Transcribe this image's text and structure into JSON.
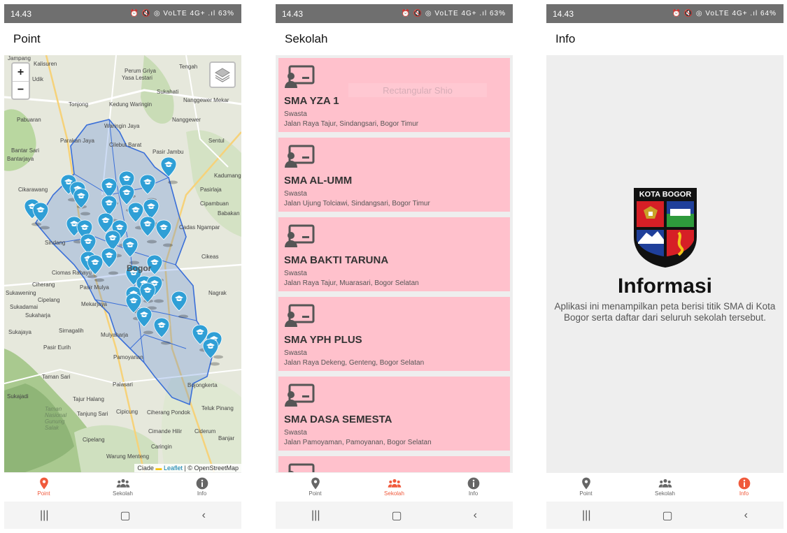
{
  "status": {
    "screen1": {
      "time": "14.43",
      "icons": "⏰ 🔇 ◎ VoLTE 4G+ .ıl",
      "battery": "63%"
    },
    "screen2": {
      "time": "14.43",
      "icons": "⏰ 🔇 ◎ VoLTE 4G+ .ıl",
      "battery": "63%"
    },
    "screen3": {
      "time": "14.43",
      "icons": "⏰ 🔇 ◎ VoLTE 4G+ .ıl",
      "battery": "64%"
    }
  },
  "screens": {
    "point_title": "Point",
    "sekolah_title": "Sekolah",
    "info_title": "Info"
  },
  "map": {
    "zoom_in": "+",
    "zoom_out": "−",
    "attribution_prefix": "Ciade",
    "attribution_leaflet": "Leaflet",
    "attribution_osm": "| © OpenStreetMap",
    "places": [
      "Jampang",
      "Kalisuren",
      "Perum Griya",
      "Yasa Lestari",
      "Tengah",
      "Udik",
      "Tonjong",
      "Kedung Waringin",
      "Sukahati",
      "Nanggewer Mekar",
      "Nanggewer",
      "Pabuaran",
      "Waringin Jaya",
      "Parakan Jaya",
      "Cilebut Barat",
      "Bantar Sari",
      "Bantarjaya",
      "Pasir Jambu",
      "Sentul",
      "Kadumangu",
      "Cikarawang",
      "Pasirlaja",
      "Cipambuan",
      "Babakan",
      "Cadas Ngampar",
      "Sindang",
      "Cikeas",
      "Ciomas Rahayu",
      "Ciherang",
      "Sukawening",
      "Pasir Mulya",
      "Nagrak",
      "Sukadamai",
      "Cipelang",
      "Sukaharja",
      "Mekarjaya",
      "Sukajaya",
      "Sirnagalih",
      "Pasir Eurih",
      "Mulyaharja",
      "Pamoyanan",
      "Taman Sari",
      "Palasari",
      "Sukajadi",
      "Tajur Halang",
      "Tanjung Sari",
      "Cipicung",
      "Ciherang Pondok",
      "Bojongkerta",
      "Teluk Pinang",
      "Cimande Hilir",
      "Ciderum",
      "Banjar",
      "Caringin",
      "Cipelang",
      "Warung Menteng",
      "Taman Nasional Gunung Salak",
      "Bogor"
    ]
  },
  "schools": [
    {
      "name": "SMA YZA 1",
      "type": "Swasta",
      "address": "Jalan Raya Tajur, Sindangsari, Bogor Timur"
    },
    {
      "name": "SMA AL-UMM",
      "type": "Swasta",
      "address": "Jalan Ujung Tolciawi, Sindangsari, Bogor Timur"
    },
    {
      "name": "SMA BAKTI TARUNA",
      "type": "Swasta",
      "address": "Jalan Raya Tajur, Muarasari, Bogor Selatan"
    },
    {
      "name": "SMA YPH PLUS",
      "type": "Swasta",
      "address": "Jalan Raya Dekeng, Genteng, Bogor Selatan"
    },
    {
      "name": "SMA DASA SEMESTA",
      "type": "Swasta",
      "address": "Jalan Pamoyaman, Pamoyanan, Bogor Selatan"
    }
  ],
  "ghost_text": "Rectangular Shio",
  "info": {
    "emblem_text": "KOTA BOGOR",
    "heading": "Informasi",
    "body": "Aplikasi ini menampilkan peta berisi titik SMA di Kota Bogor serta daftar dari seluruh sekolah tersebut."
  },
  "nav": {
    "point": "Point",
    "sekolah": "Sekolah",
    "info": "Info"
  },
  "colors": {
    "accent": "#f05a3c",
    "card": "#ffc1cc",
    "marker": "#2f9fd6",
    "boundary": "#3a6fd8"
  },
  "icons": {
    "point": "map-pin-icon",
    "sekolah": "group-icon",
    "info": "info-icon",
    "school": "teacher-board-icon",
    "recent": "recent-apps-icon",
    "home": "home-icon",
    "back": "back-icon"
  }
}
